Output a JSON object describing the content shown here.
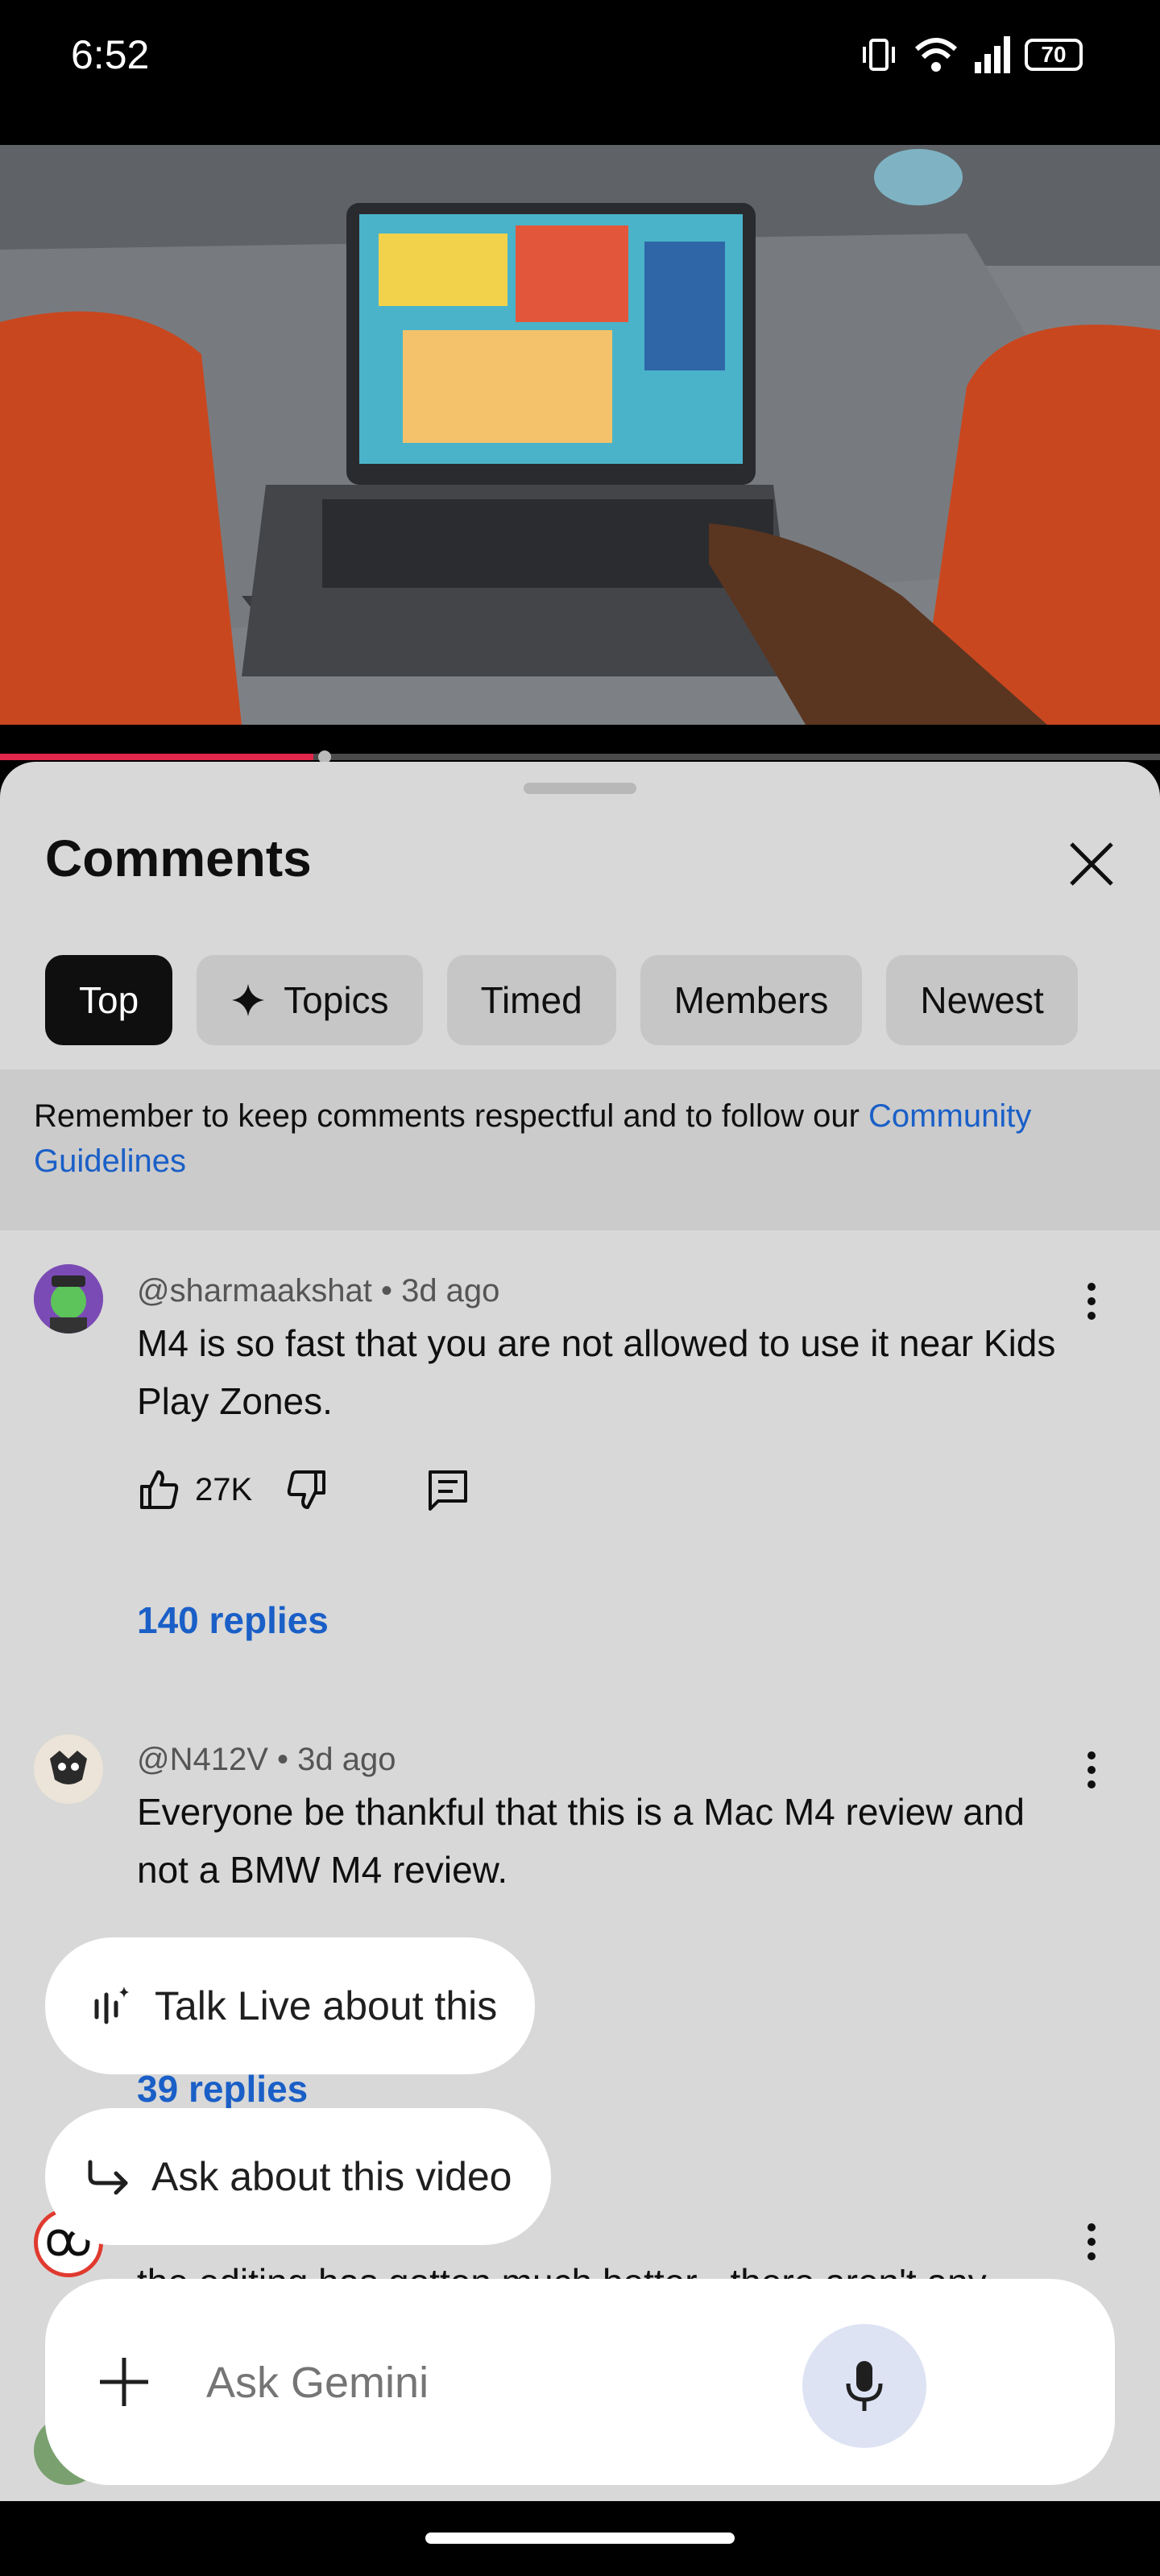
{
  "status": {
    "time": "6:52",
    "battery": "70"
  },
  "sheet": {
    "title": "Comments",
    "chips": [
      {
        "label": "Top",
        "active": true
      },
      {
        "label": "Topics",
        "active": false
      },
      {
        "label": "Timed",
        "active": false
      },
      {
        "label": "Members",
        "active": false
      },
      {
        "label": "Newest",
        "active": false
      }
    ],
    "notice_text": "Remember to keep comments respectful and to follow our ",
    "notice_link": "Community Guidelines"
  },
  "comments": [
    {
      "author": "@sharmaakshat",
      "age": "3d ago",
      "text": "M4 is so fast that you are not allowed to use it near Kids Play Zones.",
      "likes": "27K",
      "replies": "140 replies"
    },
    {
      "author": "@N412V",
      "age": "3d ago",
      "text": "Everyone be thankful that this is a Mac M4 review and not a BMW M4 review.",
      "replies": "39 replies"
    },
    {
      "partial_text": "the editing has gotten much better - there aren't any"
    }
  ],
  "gemini": {
    "talk_live": "Talk Live about this",
    "ask_video": "Ask about this video",
    "input_placeholder": "Ask Gemini"
  },
  "video": {
    "progress_fraction": 0.27
  }
}
